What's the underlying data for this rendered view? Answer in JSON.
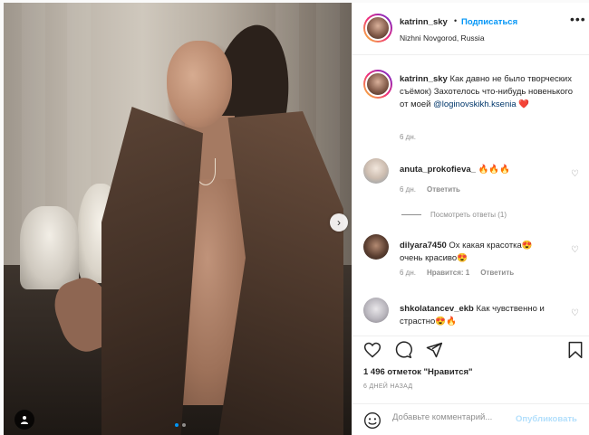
{
  "post": {
    "username": "katrinn_sky",
    "separator": "•",
    "follow_label": "Подписаться",
    "location": "Nizhni Novgorod, Russia",
    "more_icon": "more-horizontal-icon"
  },
  "caption": {
    "username": "katrinn_sky",
    "text_before": "Как давно не было творческих съёмок) Захотелось что-нибудь новенького от моей",
    "mention": "@loginovskikh.ksenia",
    "heart": "❤️",
    "time": "6 дн."
  },
  "comments": [
    {
      "username": "anuta_prokofieva_",
      "text": "🔥🔥🔥",
      "time": "6 дн.",
      "reply_label": "Ответить",
      "likes_label": ""
    },
    {
      "username": "dilyara7450",
      "text": "Ох какая красотка😍очень красиво😍",
      "time": "6 дн.",
      "likes_label": "Нравится: 1",
      "reply_label": "Ответить"
    },
    {
      "username": "shkolatancev_ekb",
      "text": "Как чувственно и страстно😍🔥",
      "time": "",
      "reply_label": "",
      "likes_label": ""
    }
  ],
  "view_replies": "Посмотреть ответы (1)",
  "actions": {
    "likes_count": "1 496",
    "likes_text": "отметок \"Нравится\"",
    "posted_ago": "6 ДНЕЙ НАЗАД",
    "comment_placeholder": "Добавьте комментарий...",
    "publish_label": "Опубликовать"
  },
  "carousel": {
    "slides": 2,
    "active_slide": 1
  },
  "colors": {
    "accent": "#0095f6",
    "heart": "#ed4956",
    "muted": "#8e8e8e",
    "publish_disabled": "#b2dffc"
  }
}
